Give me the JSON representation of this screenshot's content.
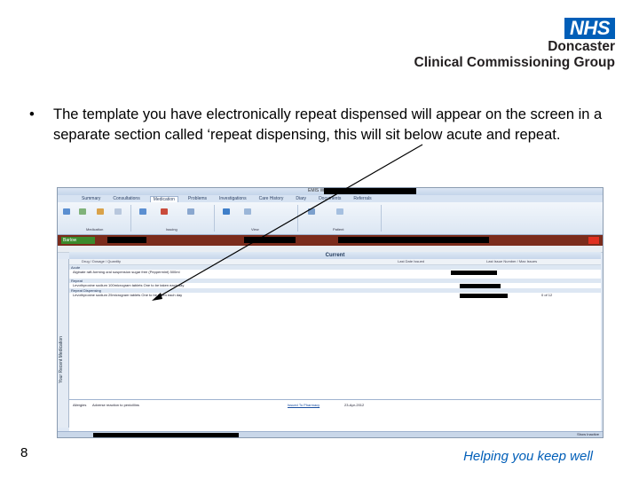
{
  "logo": {
    "nhs": "NHS",
    "line1": "Doncaster",
    "line2": "Clinical Commissioning Group"
  },
  "bullet": {
    "symbol": "•",
    "text": "The template you have electronically repeat dispensed will appear on the screen in a separate section called ‘repeat dispensing, this will sit below acute and repeat."
  },
  "screenshot": {
    "title": "EMIS Web",
    "tabs": [
      "Summary",
      "Consultations",
      "Medication",
      "Problems",
      "Investigations",
      "Care History",
      "Diary",
      "Documents",
      "Referrals"
    ],
    "active_tab": "Medication",
    "ribbon_groups": [
      "Medication",
      "Issuing",
      "View",
      "Patient"
    ],
    "patient_bar_label": "Barlow",
    "current_label": "Current",
    "columns": [
      "Drug / Dosage / Quantity",
      "Last Date Issued",
      "Last Issue Number / Max Issues"
    ],
    "sections": [
      {
        "name": "Acute",
        "rows": [
          "Alginate raft-forming oral suspension sugar free (Peppermint) 500ml"
        ]
      },
      {
        "name": "Repeat",
        "rows": [
          "Levothyroxine sodium 100microgram tablets  One to be taken each day"
        ]
      },
      {
        "name": "Repeat Dispensing",
        "rows": [
          "Levothyroxine sodium 25microgram tablets  One to be taken each day"
        ]
      }
    ],
    "repeat_count": "0 of 12",
    "side_label": "Your Recent Medication",
    "bottom_pane": {
      "allergies_label": "Allergies",
      "allergies_text": "Adverse reaction to penicillins",
      "issue_label": "Issued To Pharmacy",
      "issue_date": "23-Apr-2012",
      "status_text": "Show Inactive"
    }
  },
  "footer": {
    "page_number": "8",
    "tagline": "Helping you keep well"
  },
  "colors": {
    "nhs_blue": "#005eb8",
    "patient_bar": "#7b2c1c",
    "ribbon": "#dbe6f3"
  }
}
